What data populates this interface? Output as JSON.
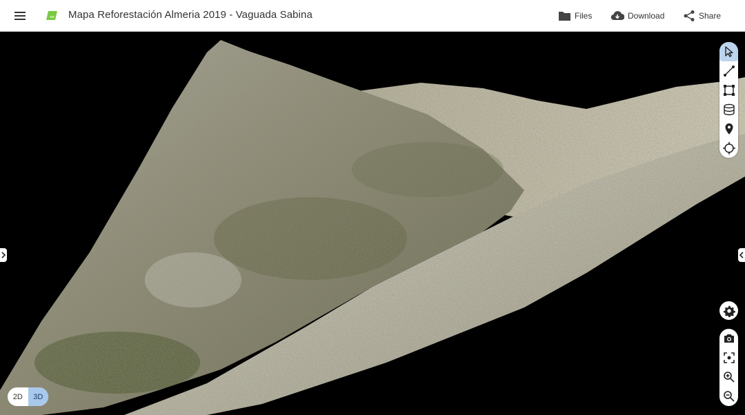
{
  "header": {
    "menu_icon": "hamburger-menu-icon",
    "logo_icon": "app-logo-icon",
    "title": "Mapa Reforestación Almeria 2019 - Vaguada Sabina",
    "actions": [
      {
        "label": "Files",
        "icon": "folder-icon"
      },
      {
        "label": "Download",
        "icon": "cloud-download-icon"
      },
      {
        "label": "Share",
        "icon": "share-icon"
      }
    ]
  },
  "toolbar": {
    "tools": [
      "pointer-icon",
      "measure-distance-icon",
      "measure-area-icon",
      "measure-volume-icon",
      "point-marker-icon",
      "crosshair-icon"
    ],
    "active_tool": "pointer-icon"
  },
  "view_controls": [
    "settings-icon",
    "camera-icon",
    "fit-view-icon",
    "zoom-in-icon",
    "zoom-out-icon"
  ],
  "view_mode": {
    "options": [
      "2D",
      "3D"
    ],
    "selected": "3D"
  },
  "colors": {
    "accent": "#a9c9ec",
    "active_tool_bg": "#bcd4ee",
    "logo_green": "#7ac943"
  }
}
